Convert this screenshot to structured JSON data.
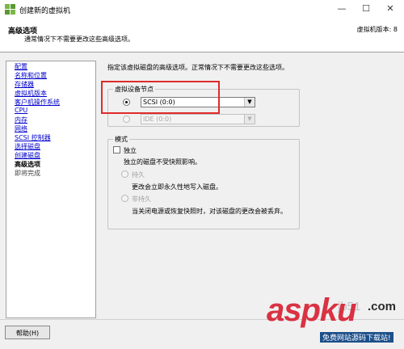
{
  "window": {
    "title": "创建新的虚拟机",
    "minimize": "—",
    "maximize": "☐",
    "close": "✕"
  },
  "header": {
    "title": "高级选项",
    "subtitle": "通常情况下不需要更改这些高级选项。",
    "version": "虚拟机版本: 8"
  },
  "nav": {
    "items": [
      {
        "label": "配置",
        "state": "link"
      },
      {
        "label": "名称和位置",
        "state": "link"
      },
      {
        "label": "存储器",
        "state": "link"
      },
      {
        "label": "虚拟机版本",
        "state": "link"
      },
      {
        "label": "客户机操作系统",
        "state": "link"
      },
      {
        "label": "CPU",
        "state": "link"
      },
      {
        "label": "内存",
        "state": "link"
      },
      {
        "label": "网络",
        "state": "link"
      },
      {
        "label": "SCSI 控制器",
        "state": "link"
      },
      {
        "label": "选择磁盘",
        "state": "link"
      },
      {
        "label": "创建磁盘",
        "state": "link"
      },
      {
        "label": "高级选项",
        "state": "current"
      },
      {
        "label": "即将完成",
        "state": "pending"
      }
    ]
  },
  "main": {
    "intro": "指定该虚拟磁盘的高级选项。正常情况下不需要更改这些选项。",
    "device_node": {
      "legend": "虚拟设备节点",
      "scsi_value": "SCSI (0:0)",
      "ide_value": "IDE (0:0)",
      "scsi_selected": true
    },
    "mode": {
      "legend": "模式",
      "independent_label": "独立",
      "independent_checked": false,
      "independent_desc": "独立的磁盘不受快照影响。",
      "persistent_label": "持久",
      "persistent_desc": "更改会立即永久性地写入磁盘。",
      "nonpersistent_label": "非持久",
      "nonpersistent_desc": "当关闭电源或恢复快照时，对该磁盘的更改会被丢弃。"
    }
  },
  "footer": {
    "help_label": "帮助(H)"
  },
  "watermark": {
    "brand": "aspku",
    "tld": ".com",
    "faint": "jb51",
    "tagline": "免费网站源码下载站!"
  },
  "colors": {
    "highlight_box": "#e02a2a",
    "nav_link": "#0000cc"
  }
}
